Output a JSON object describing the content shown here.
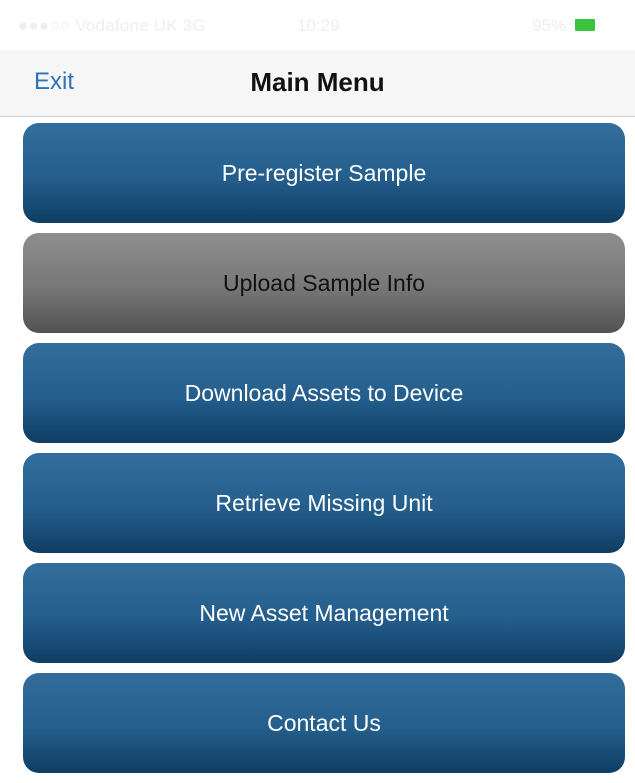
{
  "status_bar": {
    "carrier": "Vodafone UK",
    "network": "3G",
    "time": "10:29",
    "battery_percent": "95%",
    "battery_color": "#3ac43d"
  },
  "nav": {
    "exit_label": "Exit",
    "title": "Main Menu"
  },
  "menu": {
    "items": [
      {
        "label": "Pre-register Sample",
        "enabled": true
      },
      {
        "label": "Upload Sample Info",
        "enabled": false
      },
      {
        "label": "Download Assets to Device",
        "enabled": true
      },
      {
        "label": "Retrieve Missing Unit",
        "enabled": true
      },
      {
        "label": "New Asset Management",
        "enabled": true
      },
      {
        "label": "Contact Us",
        "enabled": true
      }
    ]
  },
  "colors": {
    "accent": "#2f72b8",
    "button_blue": "#245e8c",
    "button_disabled": "#777777"
  }
}
